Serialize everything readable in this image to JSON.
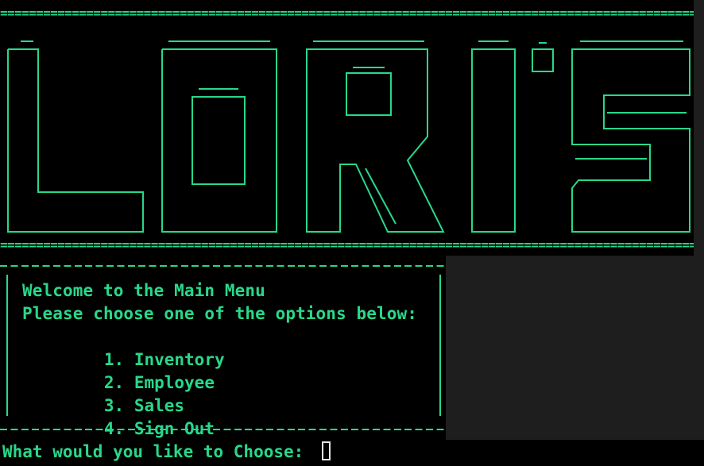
{
  "terminal": {
    "rule_top": "======================================================================================================",
    "rule_bottom": "======================================================================================================",
    "logo_alt": "LORI'S",
    "menu": {
      "welcome": "Welcome to the Main Menu",
      "instruction": "Please choose one of the options below:",
      "options": [
        {
          "number": "1.",
          "label": "Inventory"
        },
        {
          "number": "2.",
          "label": "Employee"
        },
        {
          "number": "3.",
          "label": "Sales"
        },
        {
          "number": "4.",
          "label": "Sign Out"
        }
      ]
    },
    "prompt": "What would you like to Choose: ",
    "input_value": ""
  },
  "colors": {
    "text": "#28d88a",
    "background": "#000000",
    "window": "#1e1e1e",
    "cursor": "#e6e6e6"
  }
}
